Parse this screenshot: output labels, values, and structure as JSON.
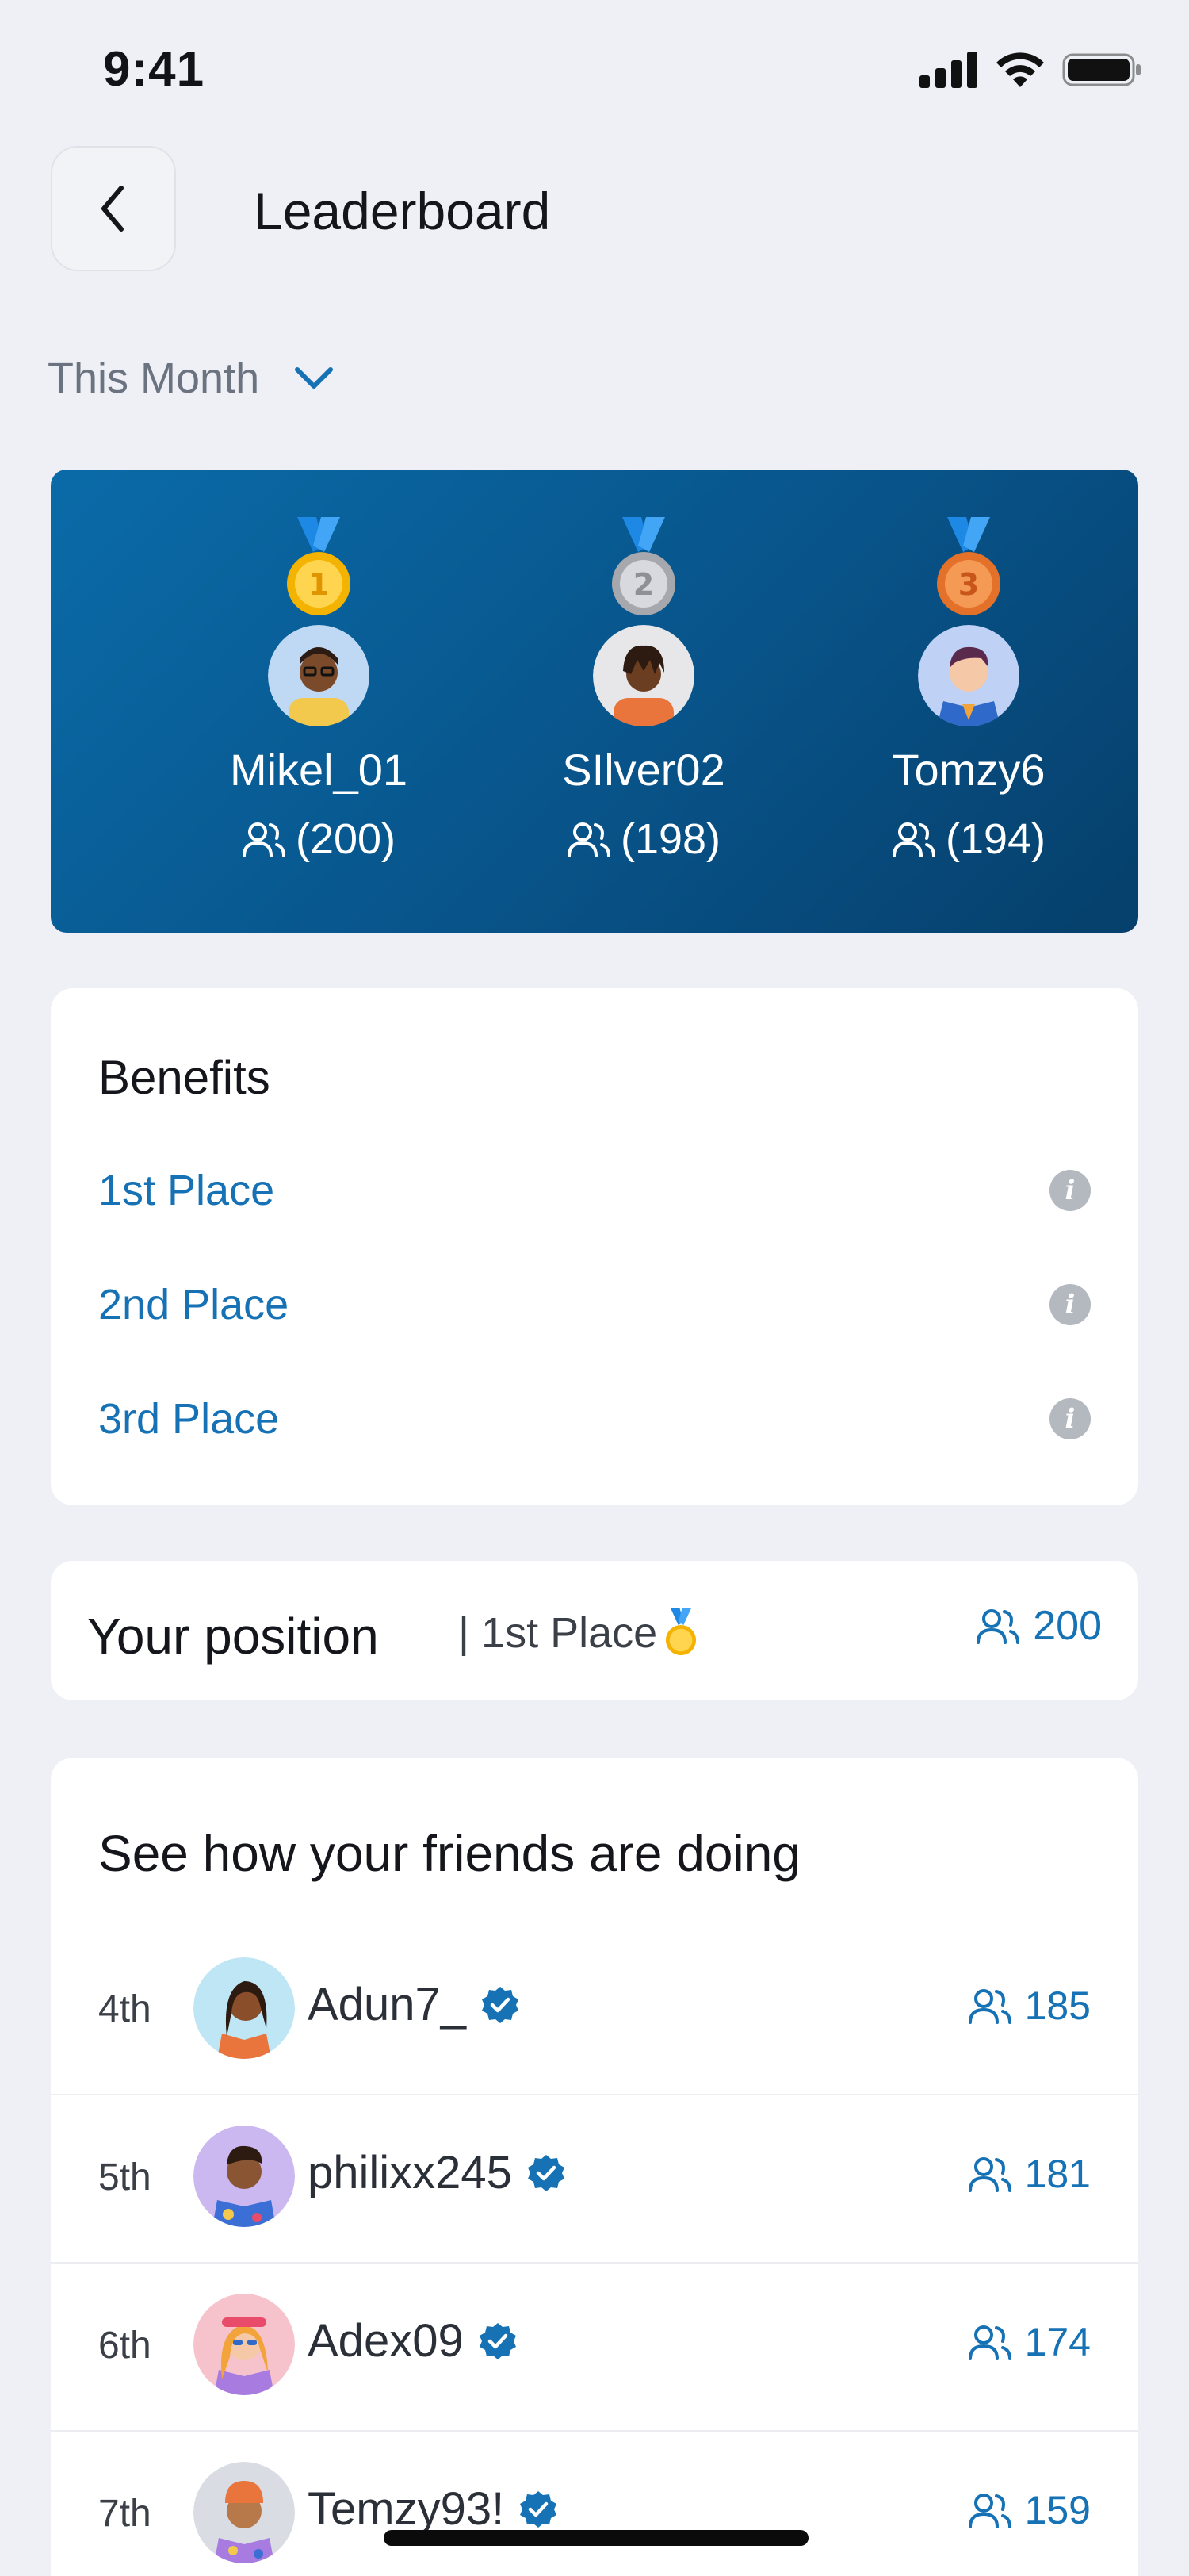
{
  "status_bar": {
    "time": "9:41"
  },
  "header": {
    "title": "Leaderboard",
    "back_icon": "chevron-left-icon"
  },
  "period": {
    "selected": "This Month",
    "icon": "chevron-down-icon"
  },
  "podium": [
    {
      "medal": "gold-medal-icon",
      "medal_number": "1",
      "name": "Mikel_01",
      "score": "(200)",
      "avatar_bg": "#BFD9F5"
    },
    {
      "medal": "silver-medal-icon",
      "medal_number": "2",
      "name": "SIlver02",
      "score": "(198)",
      "avatar_bg": "#E7E7EA"
    },
    {
      "medal": "bronze-medal-icon",
      "medal_number": "3",
      "name": "Tomzy6",
      "score": "(194)",
      "avatar_bg": "#BFD1F5"
    }
  ],
  "benefits": {
    "title": "Benefits",
    "items": [
      {
        "label": "1st Place",
        "icon": "info-icon"
      },
      {
        "label": "2nd Place",
        "icon": "info-icon"
      },
      {
        "label": "3rd Place",
        "icon": "info-icon"
      }
    ]
  },
  "position": {
    "title": "Your position",
    "place": "| 1st Place",
    "medal": "gold-medal-icon",
    "score": "200"
  },
  "friends": {
    "title": "See how your friends are doing",
    "items": [
      {
        "rank": "4th",
        "name": "Adun7_",
        "score": "185",
        "verified": true,
        "avatar_bg": "#BFE6F5"
      },
      {
        "rank": "5th",
        "name": "philixx245",
        "score": "181",
        "verified": true,
        "avatar_bg": "#CBB8F0"
      },
      {
        "rank": "6th",
        "name": "Adex09",
        "score": "174",
        "verified": true,
        "avatar_bg": "#F6C2CC"
      },
      {
        "rank": "7th",
        "name": "Temzy93!",
        "score": "159",
        "verified": true,
        "avatar_bg": "#D9DCE2"
      }
    ]
  },
  "colors": {
    "accent": "#1672B4",
    "podium_gradient_start": "#0A6BA8",
    "podium_gradient_end": "#063F6B",
    "background": "#EFF0F5"
  }
}
